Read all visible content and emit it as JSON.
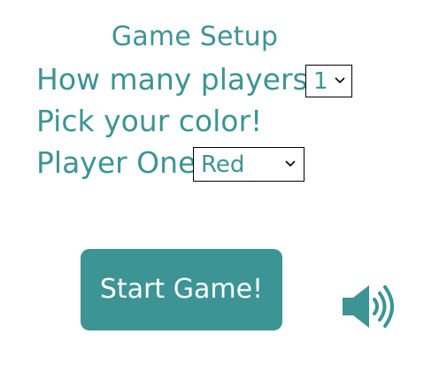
{
  "setup": {
    "title": "Game Setup",
    "players_label": "How many players?",
    "players_value": "1",
    "color_heading": "Pick your color!",
    "player_label": "Player One",
    "player_color_value": "Red"
  },
  "actions": {
    "start_label": "Start Game!"
  },
  "icons": {
    "sound": "speaker-volume-icon",
    "dropdown": "chevron-down-icon"
  },
  "colors": {
    "accent": "#3d9494",
    "background": "#ffffff",
    "button_text": "#ffffff"
  }
}
